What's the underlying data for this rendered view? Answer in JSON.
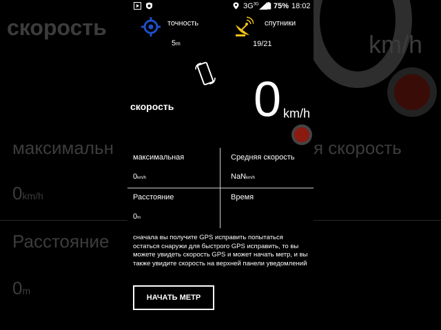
{
  "background": {
    "speed_title": "скорость",
    "max_label": "максимальн",
    "avg_label": "я скорость",
    "max_value": "0",
    "max_unit": "km/h",
    "distance_label": "Расстояние",
    "distance_value": "0",
    "distance_unit": "m",
    "speed_unit": "km/h"
  },
  "status_bar": {
    "network": "3G",
    "network_sup": "3G",
    "battery": "75%",
    "time": "18:02"
  },
  "gps": {
    "accuracy_label": "точность",
    "accuracy_value": "5",
    "accuracy_unit": "m",
    "satellites_label": "спутники",
    "satellites_value": "19/21"
  },
  "speed": {
    "label": "скорость",
    "value": "0",
    "unit": "km/h"
  },
  "stats": {
    "max_label": "максимальная",
    "max_value": "0",
    "max_unit": "km/h",
    "avg_label": "Средняя скорость",
    "avg_value": "NaN",
    "avg_unit": "km/h",
    "distance_label": "Расстояние",
    "distance_value": "0",
    "distance_unit": "m",
    "time_label": "Время"
  },
  "info_text": "сначала вы получите GPS исправить попытаться остаться снаружи для быстрого GPS исправить, то вы можете увидеть скорость GPS и может начать метр, и вы также увидите скорость на верхней панели уведомлений",
  "start_button": "НАЧАТЬ МЕТР",
  "colors": {
    "record_red": "#8b1a10",
    "accent_blue": "#1f4fc9",
    "satellite_yellow": "#f2c21b"
  }
}
